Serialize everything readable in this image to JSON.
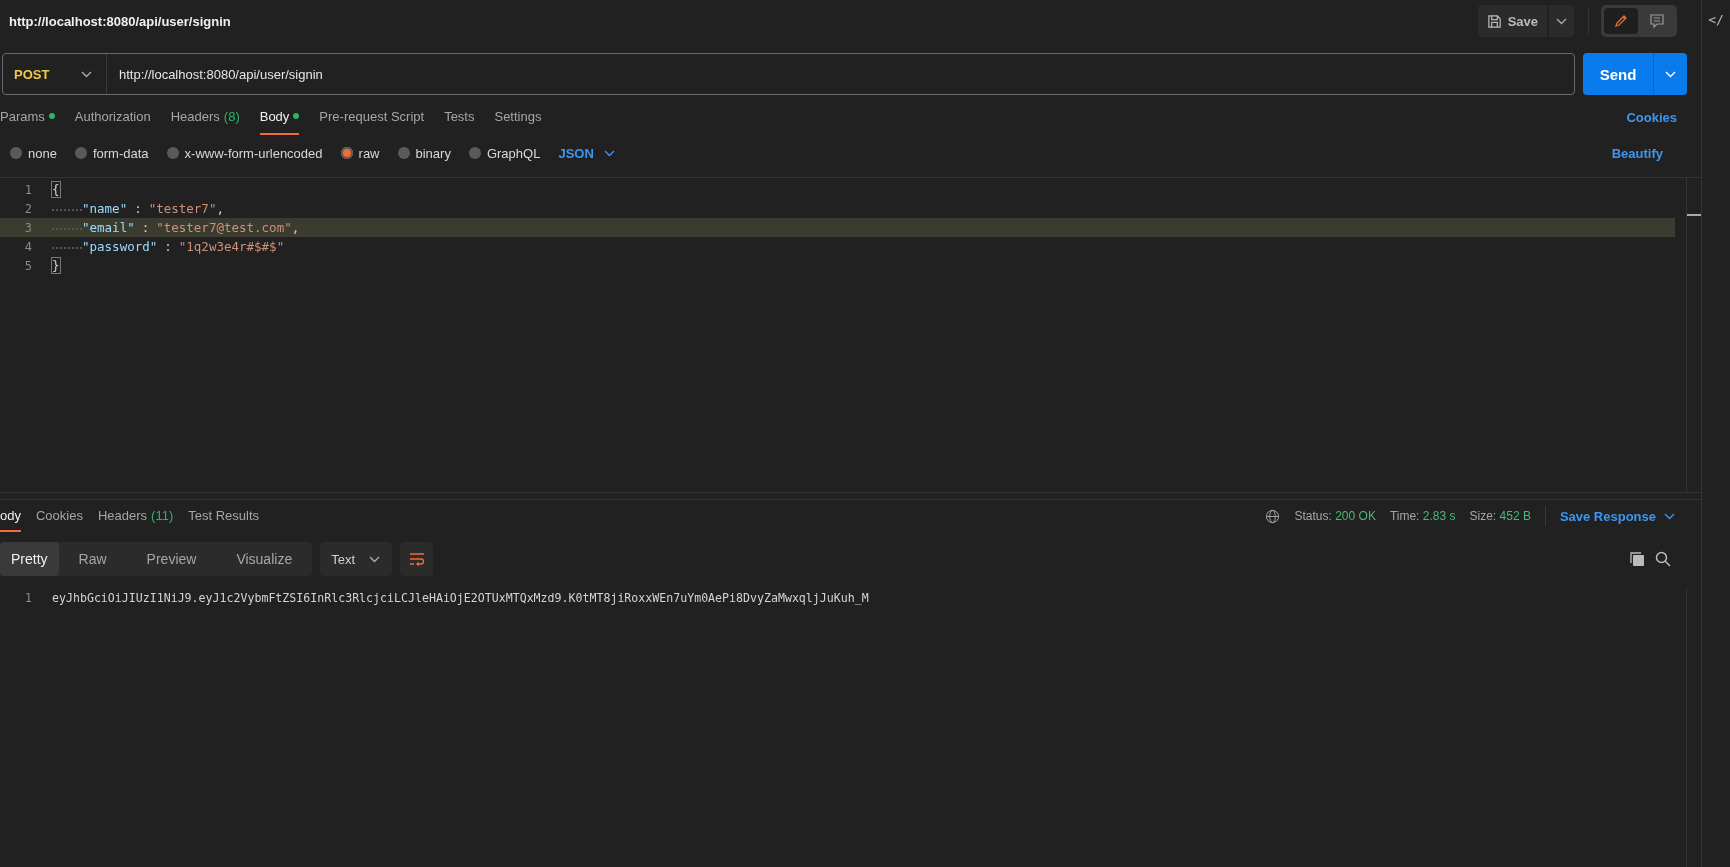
{
  "title": "http://localhost:8080/api/user/signin",
  "header_buttons": {
    "save": "Save"
  },
  "mode_toggle": [
    {
      "kind": "edit",
      "selected": true
    },
    {
      "kind": "comment",
      "selected": false
    }
  ],
  "request": {
    "method": "POST",
    "url": "http://localhost:8080/api/user/signin",
    "send": "Send"
  },
  "request_tabs": [
    {
      "label": "Params",
      "dot": true,
      "selected": false
    },
    {
      "label": "Authorization",
      "dot": false,
      "selected": false
    },
    {
      "label": "Headers",
      "count": "(8)",
      "dot": false,
      "selected": false
    },
    {
      "label": "Body",
      "dot": true,
      "selected": true
    },
    {
      "label": "Pre-request Script",
      "dot": false,
      "selected": false
    },
    {
      "label": "Tests",
      "dot": false,
      "selected": false
    },
    {
      "label": "Settings",
      "dot": false,
      "selected": false
    }
  ],
  "cookies_link": "Cookies",
  "body_types": [
    {
      "label": "none",
      "selected": false
    },
    {
      "label": "form-data",
      "selected": false
    },
    {
      "label": "x-www-form-urlencoded",
      "selected": false
    },
    {
      "label": "raw",
      "selected": true
    },
    {
      "label": "binary",
      "selected": false
    },
    {
      "label": "GraphQL",
      "selected": false
    }
  ],
  "language": "JSON",
  "beautify": "Beautify",
  "editor_lines": [
    {
      "number": "1",
      "indent": false,
      "highlighted": false,
      "tokens": [
        {
          "kind": "brace",
          "text": "{"
        }
      ]
    },
    {
      "number": "2",
      "indent": true,
      "highlighted": false,
      "tokens": [
        {
          "kind": "key",
          "text": "\"name\""
        },
        {
          "kind": "punct",
          "text": ":"
        },
        {
          "kind": "string",
          "text": "\"tester7\""
        },
        {
          "kind": "punct",
          "text": ","
        }
      ]
    },
    {
      "number": "3",
      "indent": true,
      "highlighted": true,
      "tokens": [
        {
          "kind": "key",
          "text": "\"email\""
        },
        {
          "kind": "punct",
          "text": ":"
        },
        {
          "kind": "string",
          "text": "\"tester7@test.com\""
        },
        {
          "kind": "punct",
          "text": ","
        }
      ]
    },
    {
      "number": "4",
      "indent": true,
      "highlighted": false,
      "tokens": [
        {
          "kind": "key",
          "text": "\"password\""
        },
        {
          "kind": "punct",
          "text": ":"
        },
        {
          "kind": "string",
          "text": "\"1q2w3e4r#$#$\""
        }
      ]
    },
    {
      "number": "5",
      "indent": false,
      "highlighted": false,
      "tokens": [
        {
          "kind": "brace",
          "text": "}"
        }
      ]
    }
  ],
  "response_tabs": [
    {
      "label": "ody",
      "selected": true
    },
    {
      "label": "Cookies",
      "selected": false
    },
    {
      "label": "Headers",
      "count": "(11)",
      "selected": false
    },
    {
      "label": "Test Results",
      "selected": false
    }
  ],
  "response_meta": [
    {
      "label": "Status:",
      "value": "200 OK"
    },
    {
      "label": "Time:",
      "value": "2.83 s"
    },
    {
      "label": "Size:",
      "value": "452 B"
    }
  ],
  "save_response": "Save Response",
  "view_modes": [
    {
      "label": "Pretty",
      "selected": true
    },
    {
      "label": "Raw",
      "selected": false
    },
    {
      "label": "Preview",
      "selected": false
    },
    {
      "label": "Visualize",
      "selected": false
    }
  ],
  "format": "Text",
  "response_lines": [
    {
      "number": "1",
      "text": "eyJhbGciOiJIUzI1NiJ9.eyJ1c2VybmFtZSI6InRlc3RlcjciLCJleHAiOjE2OTUxMTQxMzd9.K0tMT8jiRoxxWEn7uYm0AePi8DvyZaMwxqljJuKuh_M"
    }
  ],
  "side_strip": "</"
}
